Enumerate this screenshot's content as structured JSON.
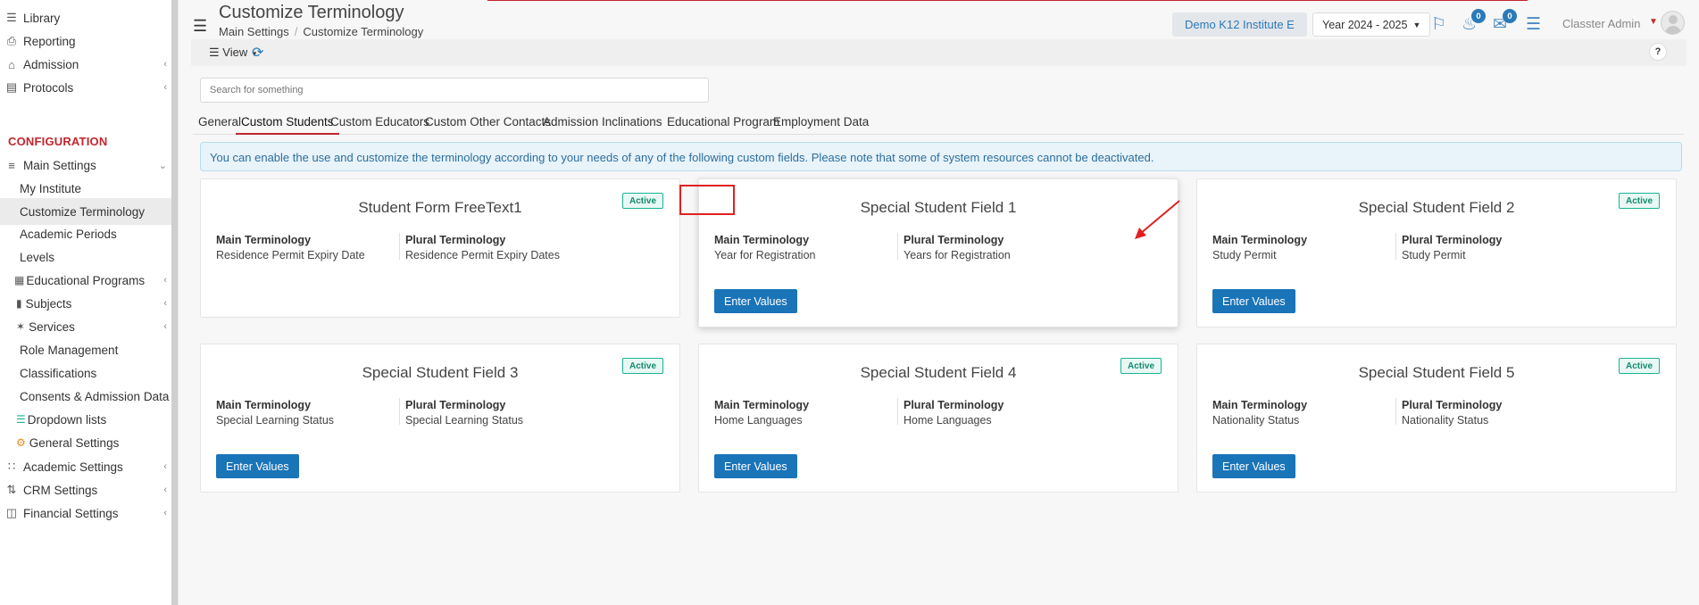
{
  "sidebar": {
    "items": [
      {
        "label": "Library",
        "icon": "library-icon"
      },
      {
        "label": "Reporting",
        "icon": "printer-icon"
      },
      {
        "label": "Admission",
        "icon": "bank-icon"
      },
      {
        "label": "Protocols",
        "icon": "protocols-icon"
      }
    ],
    "section": "CONFIGURATION",
    "main_settings": "Main Settings",
    "sub_items": [
      "My Institute",
      "Customize Terminology",
      "Academic Periods",
      "Levels",
      "Educational Programs",
      "Subjects",
      "Services",
      "Role Management",
      "Classifications",
      "Consents & Admission Data",
      "Dropdown lists",
      "General Settings"
    ],
    "bottom_items": [
      "Academic Settings",
      "CRM Settings",
      "Financial Settings"
    ]
  },
  "header": {
    "title": "Customize Terminology",
    "breadcrumb": [
      "Main Settings",
      "Customize Terminology"
    ],
    "institute": "Demo K12 Institute E",
    "year": "Year 2024 - 2025",
    "notifications": "0",
    "messages": "0",
    "user": "Classter Admin"
  },
  "toolbar": {
    "view": "View",
    "help": "?"
  },
  "search": {
    "placeholder": "Search for something"
  },
  "tabs": [
    "General",
    "Custom Students",
    "Custom Educators",
    "Custom Other Contacts",
    "Admission",
    "Inclinations",
    "Educational Program",
    "Employment Data"
  ],
  "info": "You can enable the use and customize the terminology according to your needs of any of the following custom fields. Please note that some of system resources cannot be deactivated.",
  "cards": [
    {
      "title": "Student Form FreeText1",
      "status": "Active",
      "main_label": "Main Terminology",
      "main_value": "Residence Permit Expiry Date",
      "plural_label": "Plural Terminology",
      "plural_value": "Residence Permit Expiry Dates",
      "button": ""
    },
    {
      "title": "Special Student Field 1",
      "status": "",
      "main_label": "Main Terminology",
      "main_value": "Year for Registration",
      "plural_label": "Plural Terminology",
      "plural_value": "Years for Registration",
      "button": "Enter Values"
    },
    {
      "title": "Special Student Field 2",
      "status": "Active",
      "main_label": "Main Terminology",
      "main_value": "Study Permit",
      "plural_label": "Plural Terminology",
      "plural_value": "Study Permit",
      "button": "Enter Values"
    },
    {
      "title": "Special Student Field 3",
      "status": "Active",
      "main_label": "Main Terminology",
      "main_value": "Special Learning Status",
      "plural_label": "Plural Terminology",
      "plural_value": "Special Learning Status",
      "button": "Enter Values"
    },
    {
      "title": "Special Student Field 4",
      "status": "Active",
      "main_label": "Main Terminology",
      "main_value": "Home Languages",
      "plural_label": "Plural Terminology",
      "plural_value": "Home Languages",
      "button": "Enter Values"
    },
    {
      "title": "Special Student Field 5",
      "status": "Active",
      "main_label": "Main Terminology",
      "main_value": "Nationality Status",
      "plural_label": "Plural Terminology",
      "plural_value": "Nationality Status",
      "button": "Enter Values"
    }
  ]
}
